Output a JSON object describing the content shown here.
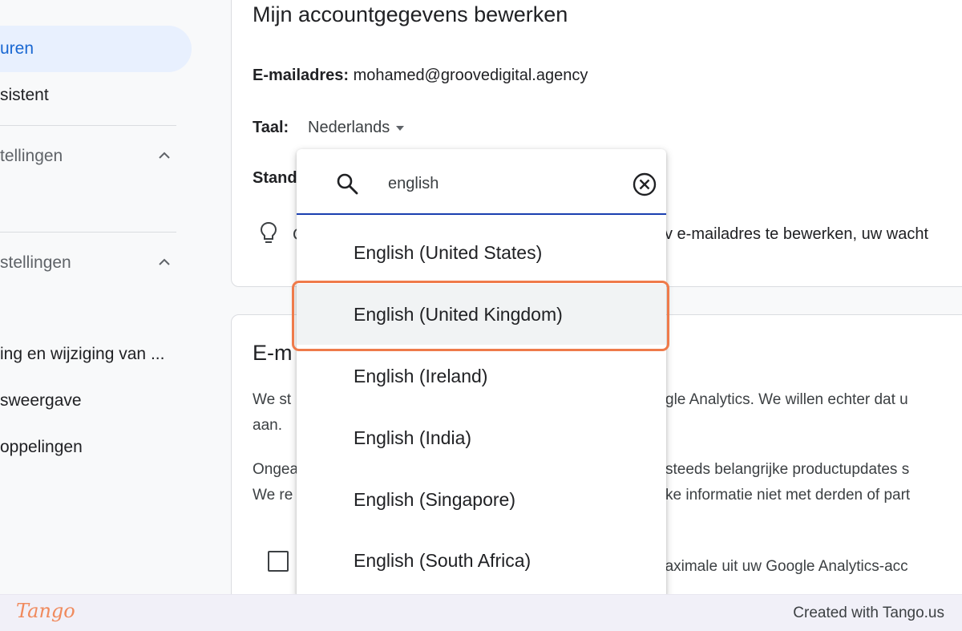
{
  "sidebar": {
    "active_item": "uren",
    "item_assistent": "sistent",
    "section1": "tellingen",
    "section2": "stellingen",
    "item_wijziging": "ing en wijziging van ...",
    "item_weergave": "sweergave",
    "item_koppelingen": "oppelingen"
  },
  "account_card": {
    "title": "Mijn accountgegevens bewerken",
    "email_label": "E-mailadres:",
    "email_value": "mohamed@groovedigital.agency",
    "language_label": "Taal:",
    "language_value": "Nederlands",
    "standard_label": "Stand",
    "tip_visible_letter": "C",
    "tip_text": "v e-mailadres te bewerken, uw wacht"
  },
  "email_card": {
    "title": "E-m",
    "p1_left": "We st",
    "p1_right": "gle Analytics. We willen echter dat u",
    "p1_line2": "aan.",
    "p2_left": "Ongea",
    "p2_right": "steeds belangrijke productupdates s",
    "p3_left": "We re",
    "p3_right": "ke informatie niet met derden of part",
    "checkbox_text": "haximale uit uw Google Analytics-acc"
  },
  "dropdown": {
    "search_value": "english",
    "options": [
      "English (United States)",
      "English (United Kingdom)",
      "English (Ireland)",
      "English (India)",
      "English (Singapore)",
      "English (South Africa)"
    ],
    "highlighted_index": 1,
    "clear_icon": "close-circle-icon",
    "search_icon": "search-icon"
  },
  "footer": {
    "logo": "Tango",
    "credit": "Created with Tango.us"
  },
  "colors": {
    "active_bg": "#e8f0fe",
    "active_text": "#1967d2",
    "search_underline": "#1a3fb0",
    "highlight_border": "#ef7a4a",
    "tango_orange": "#f08a5d"
  }
}
